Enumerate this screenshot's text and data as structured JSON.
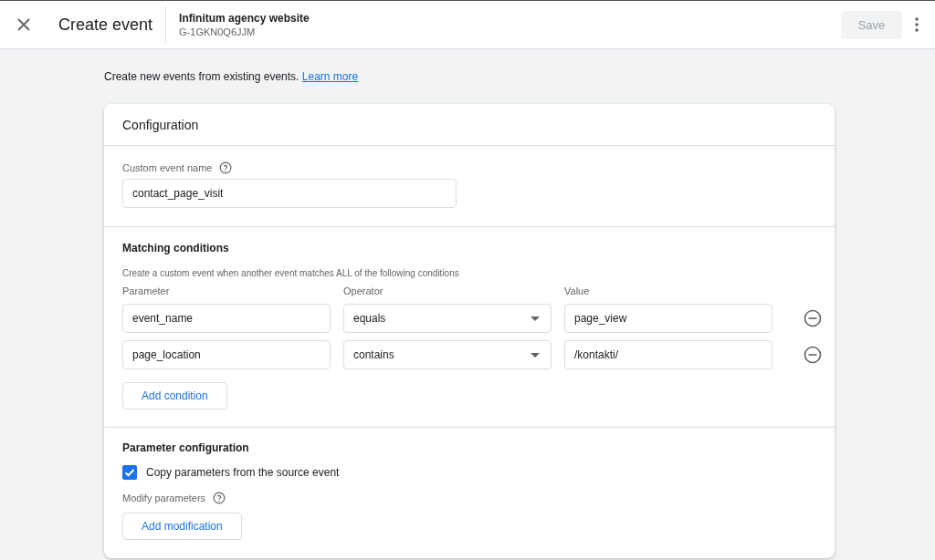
{
  "header": {
    "title": "Create event",
    "property_name": "Infinitum agency website",
    "property_id": "G-1GKN0Q6JJM",
    "save": {
      "label": "Save",
      "disabled": true
    }
  },
  "intro": {
    "text": "Create new events from existing events.",
    "link": "Learn more"
  },
  "card": {
    "title": "Configuration",
    "custom_event_name": {
      "label": "Custom event name",
      "value": "contact_page_visit"
    },
    "matching_conditions": {
      "title": "Matching conditions",
      "description": "Create a custom event when another event matches ALL of the following conditions",
      "columns": [
        "Parameter",
        "Operator",
        "Value"
      ],
      "rows": [
        {
          "parameter": "event_name",
          "operator": "equals",
          "value": "page_view"
        },
        {
          "parameter": "page_location",
          "operator": "contains",
          "value": "/kontakti/"
        }
      ],
      "add_button": "Add condition"
    },
    "parameter_configuration": {
      "title": "Parameter configuration",
      "copy": {
        "label": "Copy parameters from the source event",
        "checked": true
      },
      "modify_label": "Modify parameters",
      "add_button": "Add modification"
    }
  }
}
